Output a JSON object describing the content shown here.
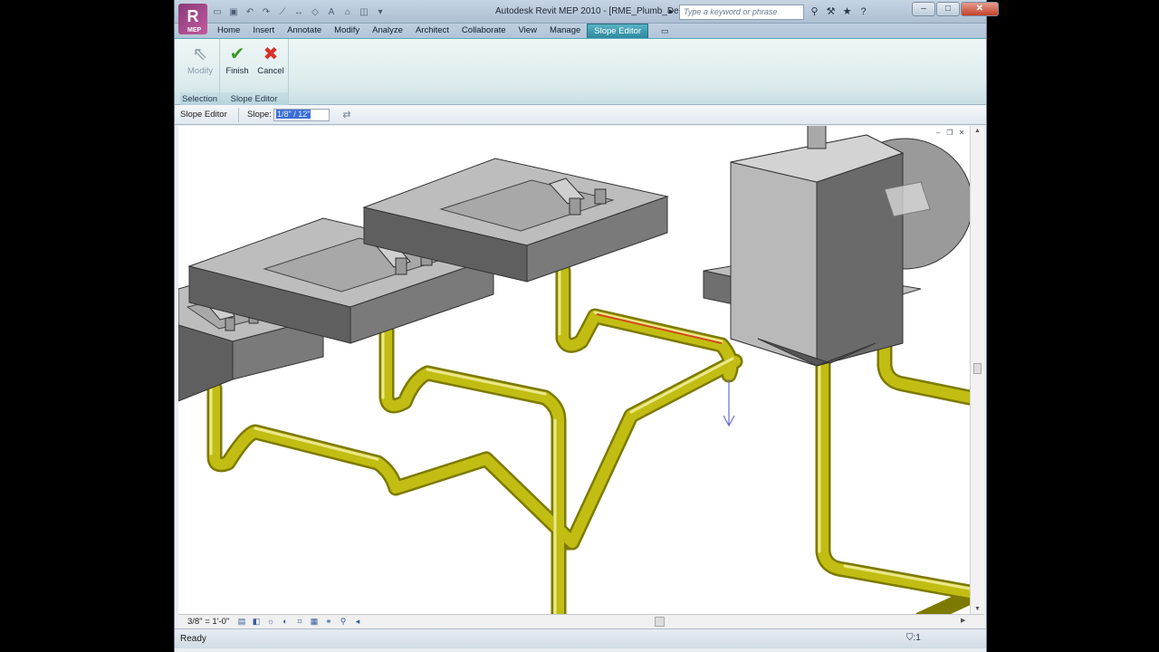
{
  "titlebar": {
    "logo_letter": "R",
    "logo_sub": "MEP",
    "window_title": "Autodesk Revit MEP 2010 - [RME_Plumb_Des...",
    "search_placeholder": "Type a keyword or phrase",
    "quick_access_icons": [
      "open-icon",
      "save-icon",
      "undo-icon",
      "redo-icon",
      "measure-icon",
      "dimension-icon",
      "tag-icon",
      "text-icon",
      "3d-view-icon",
      "section-icon",
      "dropdown-icon"
    ],
    "help_icons": [
      "binoculars-icon",
      "subscription-icon",
      "favorites-icon",
      "help-icon"
    ]
  },
  "ribbon_tabs": [
    {
      "label": "Home",
      "active": false
    },
    {
      "label": "Insert",
      "active": false
    },
    {
      "label": "Annotate",
      "active": false
    },
    {
      "label": "Modify",
      "active": false
    },
    {
      "label": "Analyze",
      "active": false
    },
    {
      "label": "Architect",
      "active": false
    },
    {
      "label": "Collaborate",
      "active": false
    },
    {
      "label": "View",
      "active": false
    },
    {
      "label": "Manage",
      "active": false
    },
    {
      "label": "Slope Editor",
      "active": true
    }
  ],
  "ribbon": {
    "selection_group": {
      "label": "Selection",
      "modify_label": "Modify"
    },
    "slope_group": {
      "label": "Slope Editor",
      "finish_label": "Finish",
      "cancel_label": "Cancel"
    }
  },
  "options_bar": {
    "context": "Slope Editor",
    "slope_label": "Slope:",
    "slope_value": "1/8\" / 12\""
  },
  "view_bar": {
    "scale": "3/8\" = 1'-0\""
  },
  "status": {
    "text": "Ready",
    "filter_count": ":1"
  },
  "colors": {
    "pipe": "#b8b400",
    "pipe_highlight": "#e4e06a",
    "fixture_top": "#bdbdbd",
    "fixture_side": "#6f6f6f",
    "selected_pipe": "#d24a1c",
    "flow_arrow": "#6b6bd6"
  }
}
